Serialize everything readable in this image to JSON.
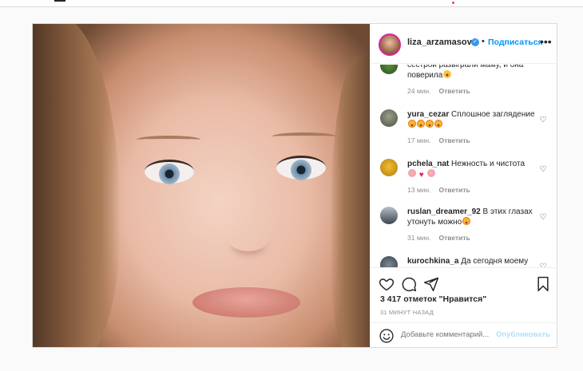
{
  "post": {
    "username": "liza_arzamasova",
    "follow_label": "Подписаться",
    "dot": "•",
    "more_label": "•••"
  },
  "comments": [
    {
      "username": "",
      "text": "сестрой разыграли маму, и она поверила",
      "time": "24 мин.",
      "reply": "Ответить",
      "emoji": [
        "smile"
      ]
    },
    {
      "username": "yura_cezar",
      "text": "Сплошное заглядение",
      "time": "17 мин.",
      "reply": "Ответить",
      "emoji": [
        "hearteyes",
        "hearteyes",
        "hearteyes",
        "hearteyes"
      ]
    },
    {
      "username": "pchela_nat",
      "text": "Нежность и чистота",
      "time": "13 мин.",
      "reply": "Ответить",
      "emoji": [
        "flower",
        "redheart",
        "flower"
      ]
    },
    {
      "username": "ruslan_dreamer_92",
      "text": "В этих глазах утонуть можно",
      "time": "31 мин.",
      "reply": "Ответить",
      "emoji": [
        "hearteyes"
      ]
    },
    {
      "username": "kurochkina_a",
      "text": "Да сегодня моему",
      "time": "",
      "reply": "",
      "emoji": []
    }
  ],
  "actions": {
    "likes": "3 417 отметок \"Нравится\"",
    "timestamp": "31 МИНУТ НАЗАД",
    "comment_placeholder": "Добавьте комментарий...",
    "publish_label": "Опубликовать"
  },
  "colors": {
    "link_blue": "#0095f6",
    "verified_blue": "#3897f0",
    "muted": "#8e8e8e",
    "publish_disabled": "#b2dffc"
  }
}
